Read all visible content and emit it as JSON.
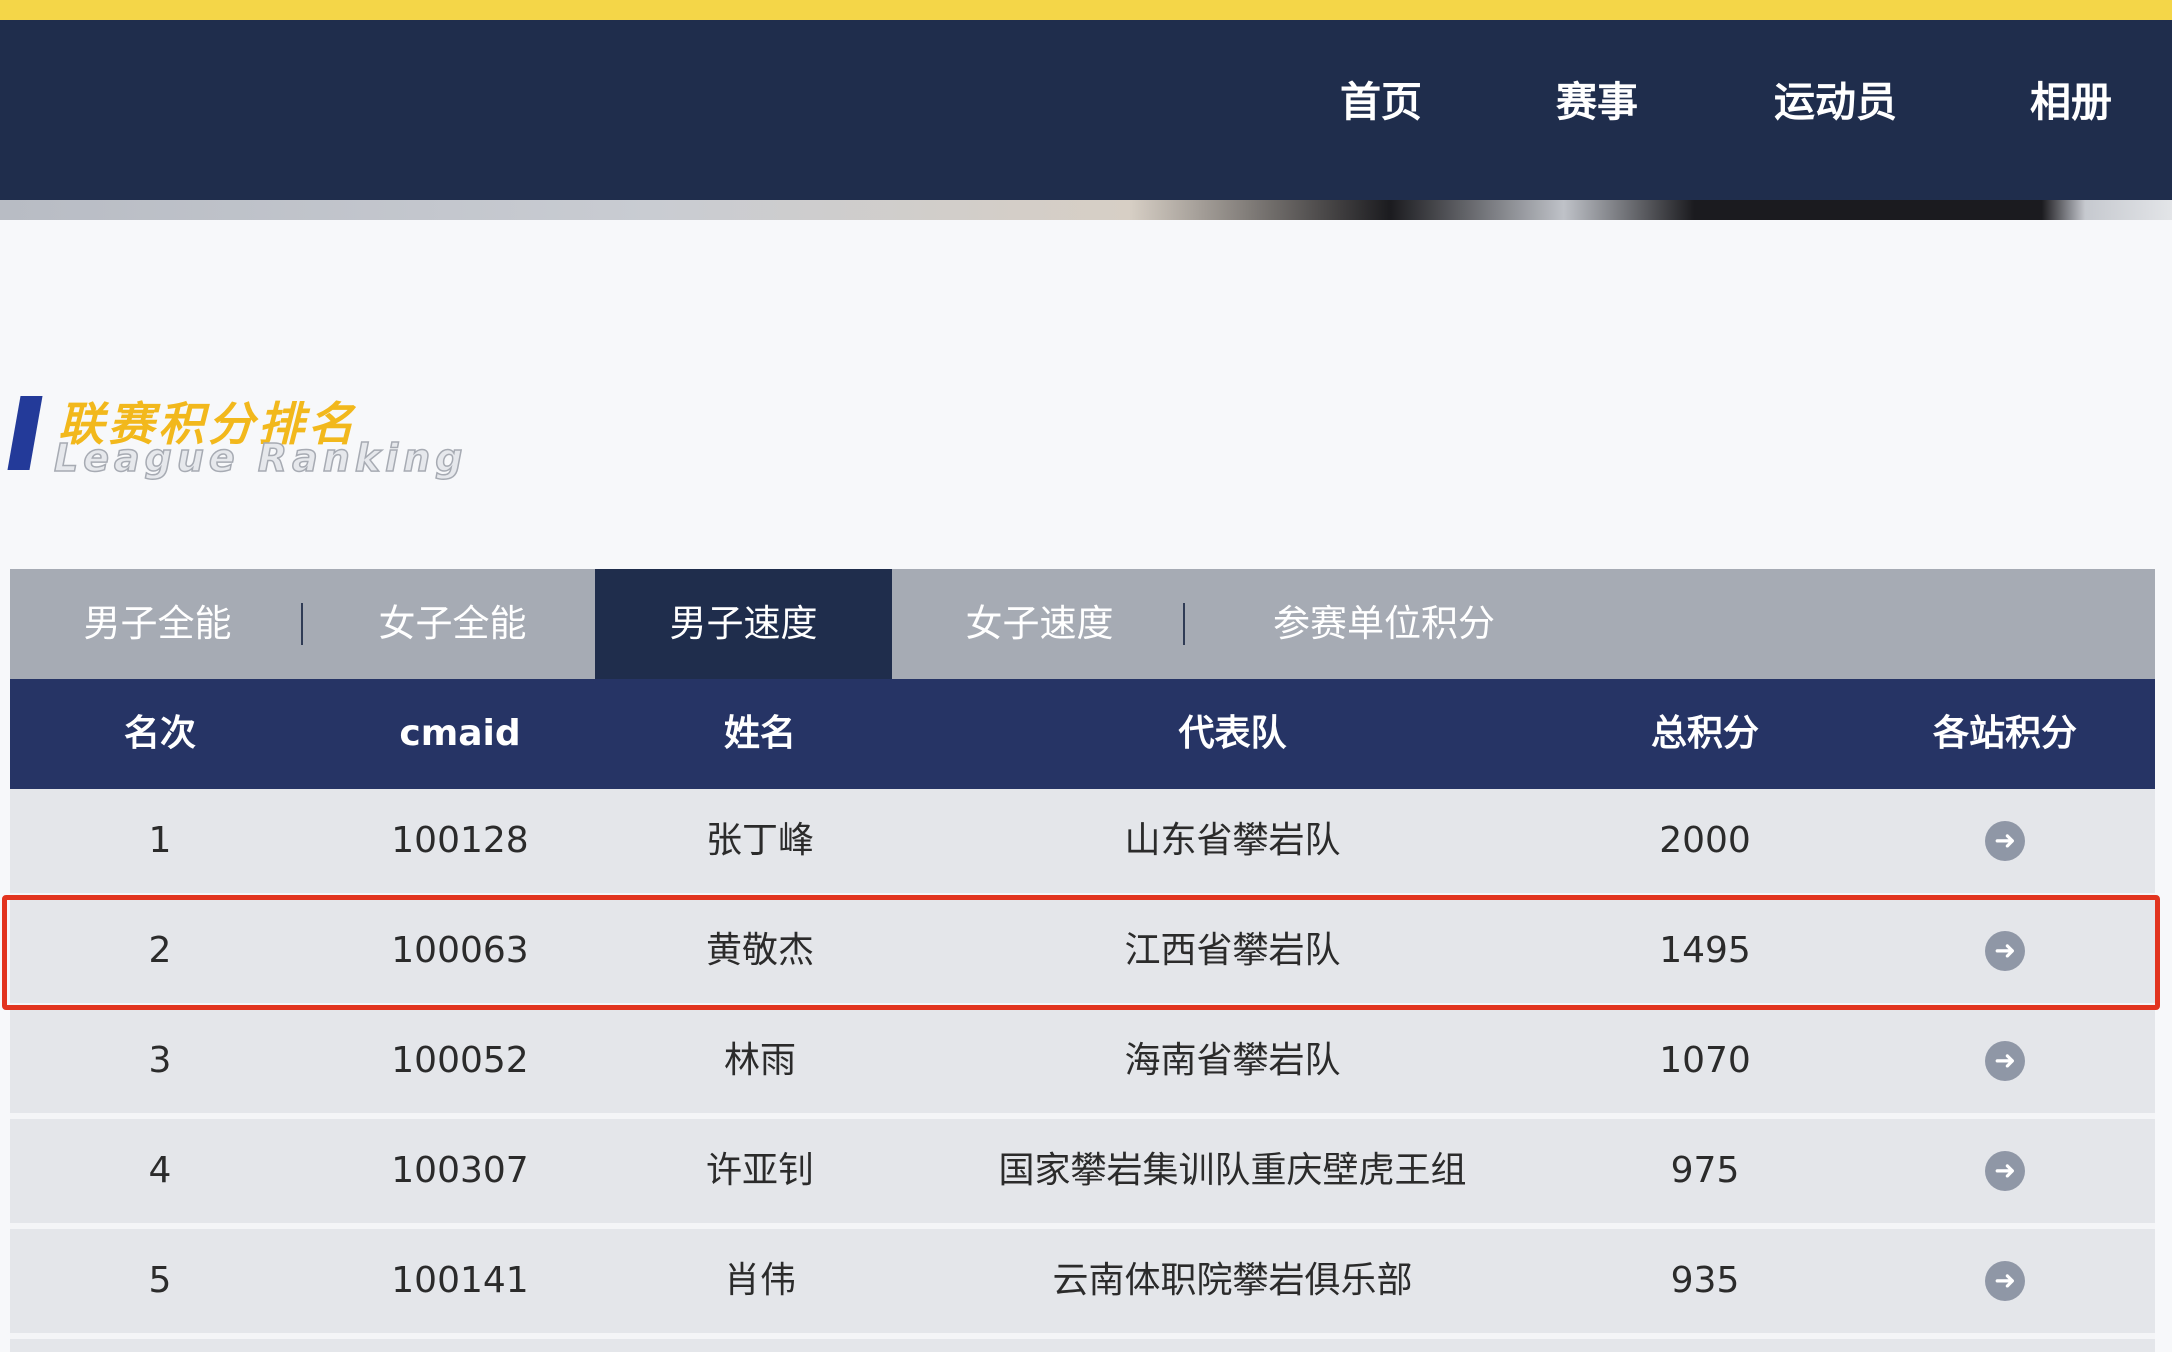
{
  "nav": {
    "items": [
      "首页",
      "赛事",
      "运动员",
      "相册"
    ]
  },
  "section": {
    "title_cn": "联赛积分排名",
    "title_en": "League Ranking"
  },
  "tabs": [
    "男子全能",
    "女子全能",
    "男子速度",
    "女子速度",
    "参赛单位积分"
  ],
  "active_tab": "男子速度",
  "table": {
    "headers": [
      "名次",
      "cmaid",
      "姓名",
      "代表队",
      "总积分",
      "各站积分"
    ],
    "rows": [
      [
        "1",
        "100128",
        "张丁峰",
        "山东省攀岩队",
        "2000"
      ],
      [
        "2",
        "100063",
        "黄敬杰",
        "江西省攀岩队",
        "1495"
      ],
      [
        "3",
        "100052",
        "林雨",
        "海南省攀岩队",
        "1070"
      ],
      [
        "4",
        "100307",
        "许亚钊",
        "国家攀岩集训队重庆壁虎王组",
        "975"
      ],
      [
        "5",
        "100141",
        "肖伟",
        "云南体职院攀岩俱乐部",
        "935"
      ]
    ],
    "highlighted_rank": "2"
  },
  "icons": {
    "detail": "arrow-right-circle-icon"
  },
  "colors": {
    "nav_bg": "#1f2d4c",
    "accent_yellow": "#f4d648",
    "header_bg": "#263465",
    "tab_bg": "#a6abb4",
    "highlight": "#e2341f",
    "title_yellow": "#f2b81c"
  }
}
